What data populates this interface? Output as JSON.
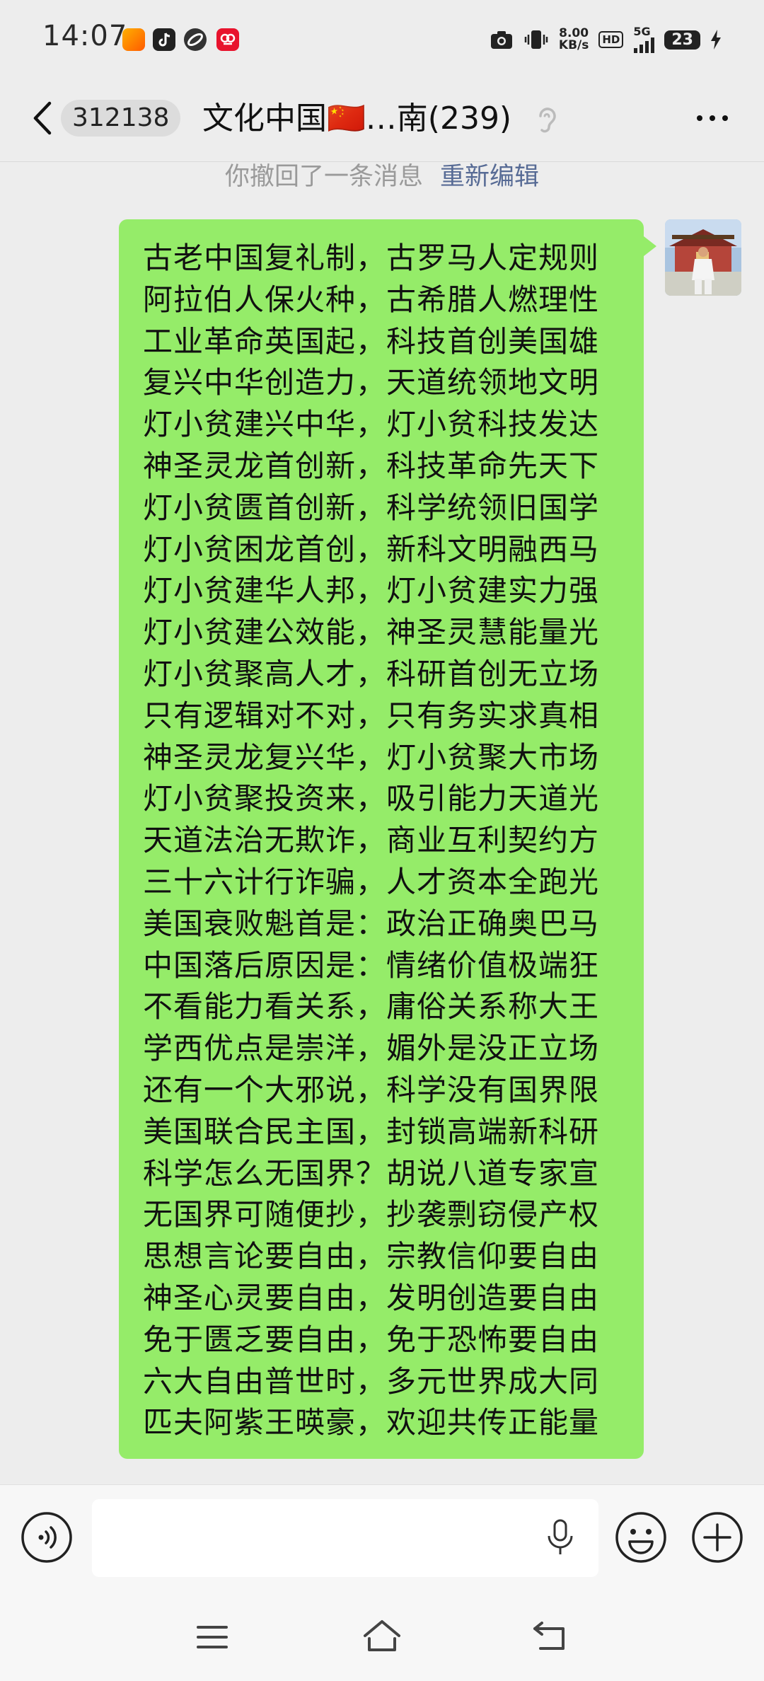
{
  "status_bar": {
    "time": "14:07",
    "net_speed_value": "8.00",
    "net_speed_unit": "KB/s",
    "hd_label": "HD",
    "network_label": "5G",
    "battery_level": "23",
    "icons": [
      "app-video-icon",
      "tiktok-icon",
      "app-link-icon",
      "app-red-icon",
      "camera-icon",
      "vibrate-icon",
      "signal-icon",
      "charging-icon"
    ]
  },
  "header": {
    "unread_count": "312138",
    "title": "文化中国🇨🇳…南(239)"
  },
  "notice": {
    "text": "你撤回了一条消息",
    "action": "重新编辑"
  },
  "message": {
    "lines": [
      "古老中国复礼制，古罗马人定规则",
      "阿拉伯人保火种，古希腊人燃理性",
      "工业革命英国起，科技首创美国雄",
      "复兴中华创造力，天道统领地文明",
      "灯小贫建兴中华，灯小贫科技发达",
      "神圣灵龙首创新，科技革命先天下",
      "灯小贫匮首创新，科学统领旧国学",
      "灯小贫困龙首创，新科文明融西马",
      "灯小贫建华人邦，灯小贫建实力强",
      "灯小贫建公效能，神圣灵慧能量光",
      "灯小贫聚高人才，科研首创无立场",
      "只有逻辑对不对，只有务实求真相",
      "神圣灵龙复兴华，灯小贫聚大市场",
      "灯小贫聚投资来，吸引能力天道光",
      "天道法治无欺诈，商业互利契约方",
      "三十六计行诈骗，人才资本全跑光",
      "美国衰败魁首是：政治正确奥巴马",
      "中国落后原因是：情绪价值极端狂",
      "不看能力看关系，庸俗关系称大王",
      "学西优点是崇洋，媚外是没正立场",
      "还有一个大邪说，科学没有国界限",
      "美国联合民主国，封锁高端新科研",
      "科学怎么无国界？胡说八道专家宣",
      "无国界可随便抄，抄袭剽窃侵产权",
      "思想言论要自由，宗教信仰要自由",
      "神圣心灵要自由，发明创造要自由",
      "免于匮乏要自由，免于恐怖要自由",
      "六大自由普世时，多元世界成大同",
      "匹夫阿紫王暎豪，欢迎共传正能量"
    ],
    "bubble_color": "#95ec69"
  },
  "input_bar": {
    "placeholder": "",
    "icons": [
      "voice-icon",
      "mic-icon",
      "emoji-icon",
      "plus-icon"
    ]
  },
  "nav_bar": {
    "icons": [
      "menu-icon",
      "home-icon",
      "back-icon"
    ]
  },
  "colors": {
    "background": "#ededed",
    "link": "#576b95",
    "bubble": "#95ec69"
  }
}
